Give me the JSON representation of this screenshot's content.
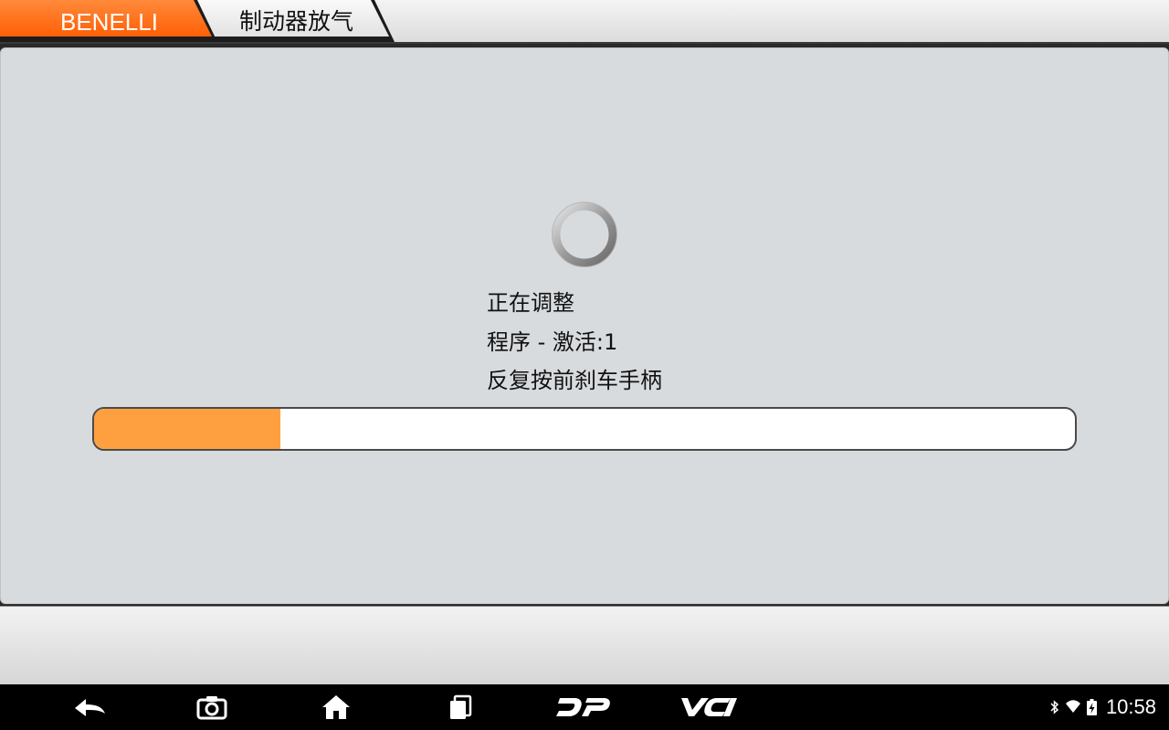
{
  "breadcrumb": {
    "brand": "BENELLI",
    "function": "制动器放气"
  },
  "main": {
    "status_line": "正在调整",
    "program_line": "程序 - 激活:1",
    "instruction_line": "反复按前刹车手柄",
    "progress_fraction": 0.19
  },
  "navbar": {
    "icons": [
      "back-icon",
      "camera-icon",
      "home-icon",
      "recent-apps-icon",
      "dp-icon",
      "vci-icon"
    ],
    "status_icons": [
      "bluetooth-icon",
      "wifi-icon",
      "battery-charging-icon"
    ],
    "time": "10:58"
  },
  "colors": {
    "brand_tab": "#ff6a13",
    "progress_fill": "#ffa040",
    "panel_bg": "#d8dbde"
  }
}
